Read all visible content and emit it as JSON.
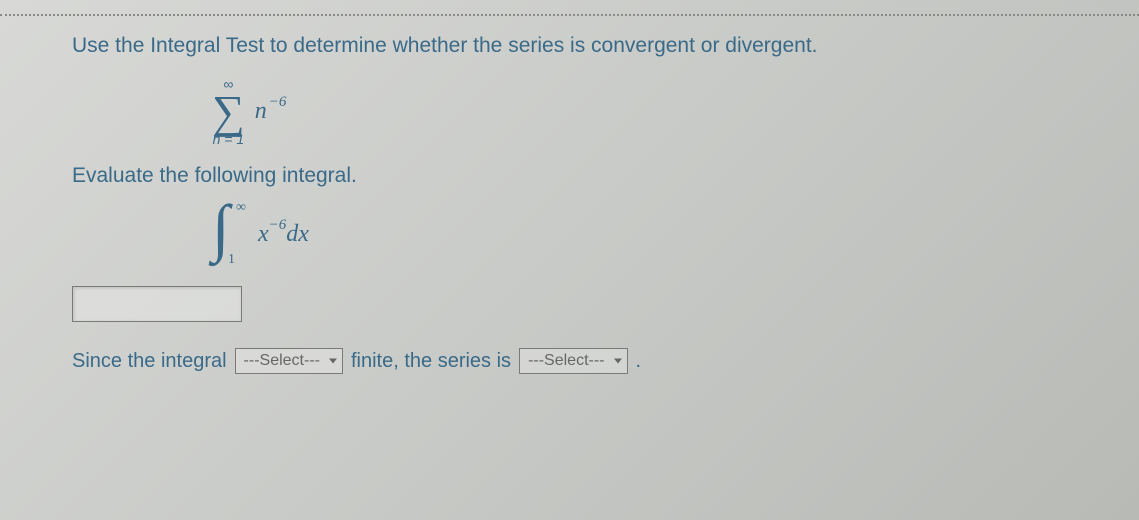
{
  "question": {
    "title": "Use the Integral Test to determine whether the series is convergent or divergent.",
    "series": {
      "upper": "∞",
      "lower": "n = 1",
      "base": "n",
      "exponent": "−6"
    },
    "subhead": "Evaluate the following integral.",
    "integral": {
      "upper": "∞",
      "lower": "1",
      "base": "x",
      "exponent": "−6",
      "dx": "dx"
    },
    "answer_value": "",
    "sentence": {
      "part1": "Since the integral",
      "select1_placeholder": "---Select---",
      "part2": "finite, the series is",
      "select2_placeholder": "---Select---",
      "part3": "."
    }
  }
}
